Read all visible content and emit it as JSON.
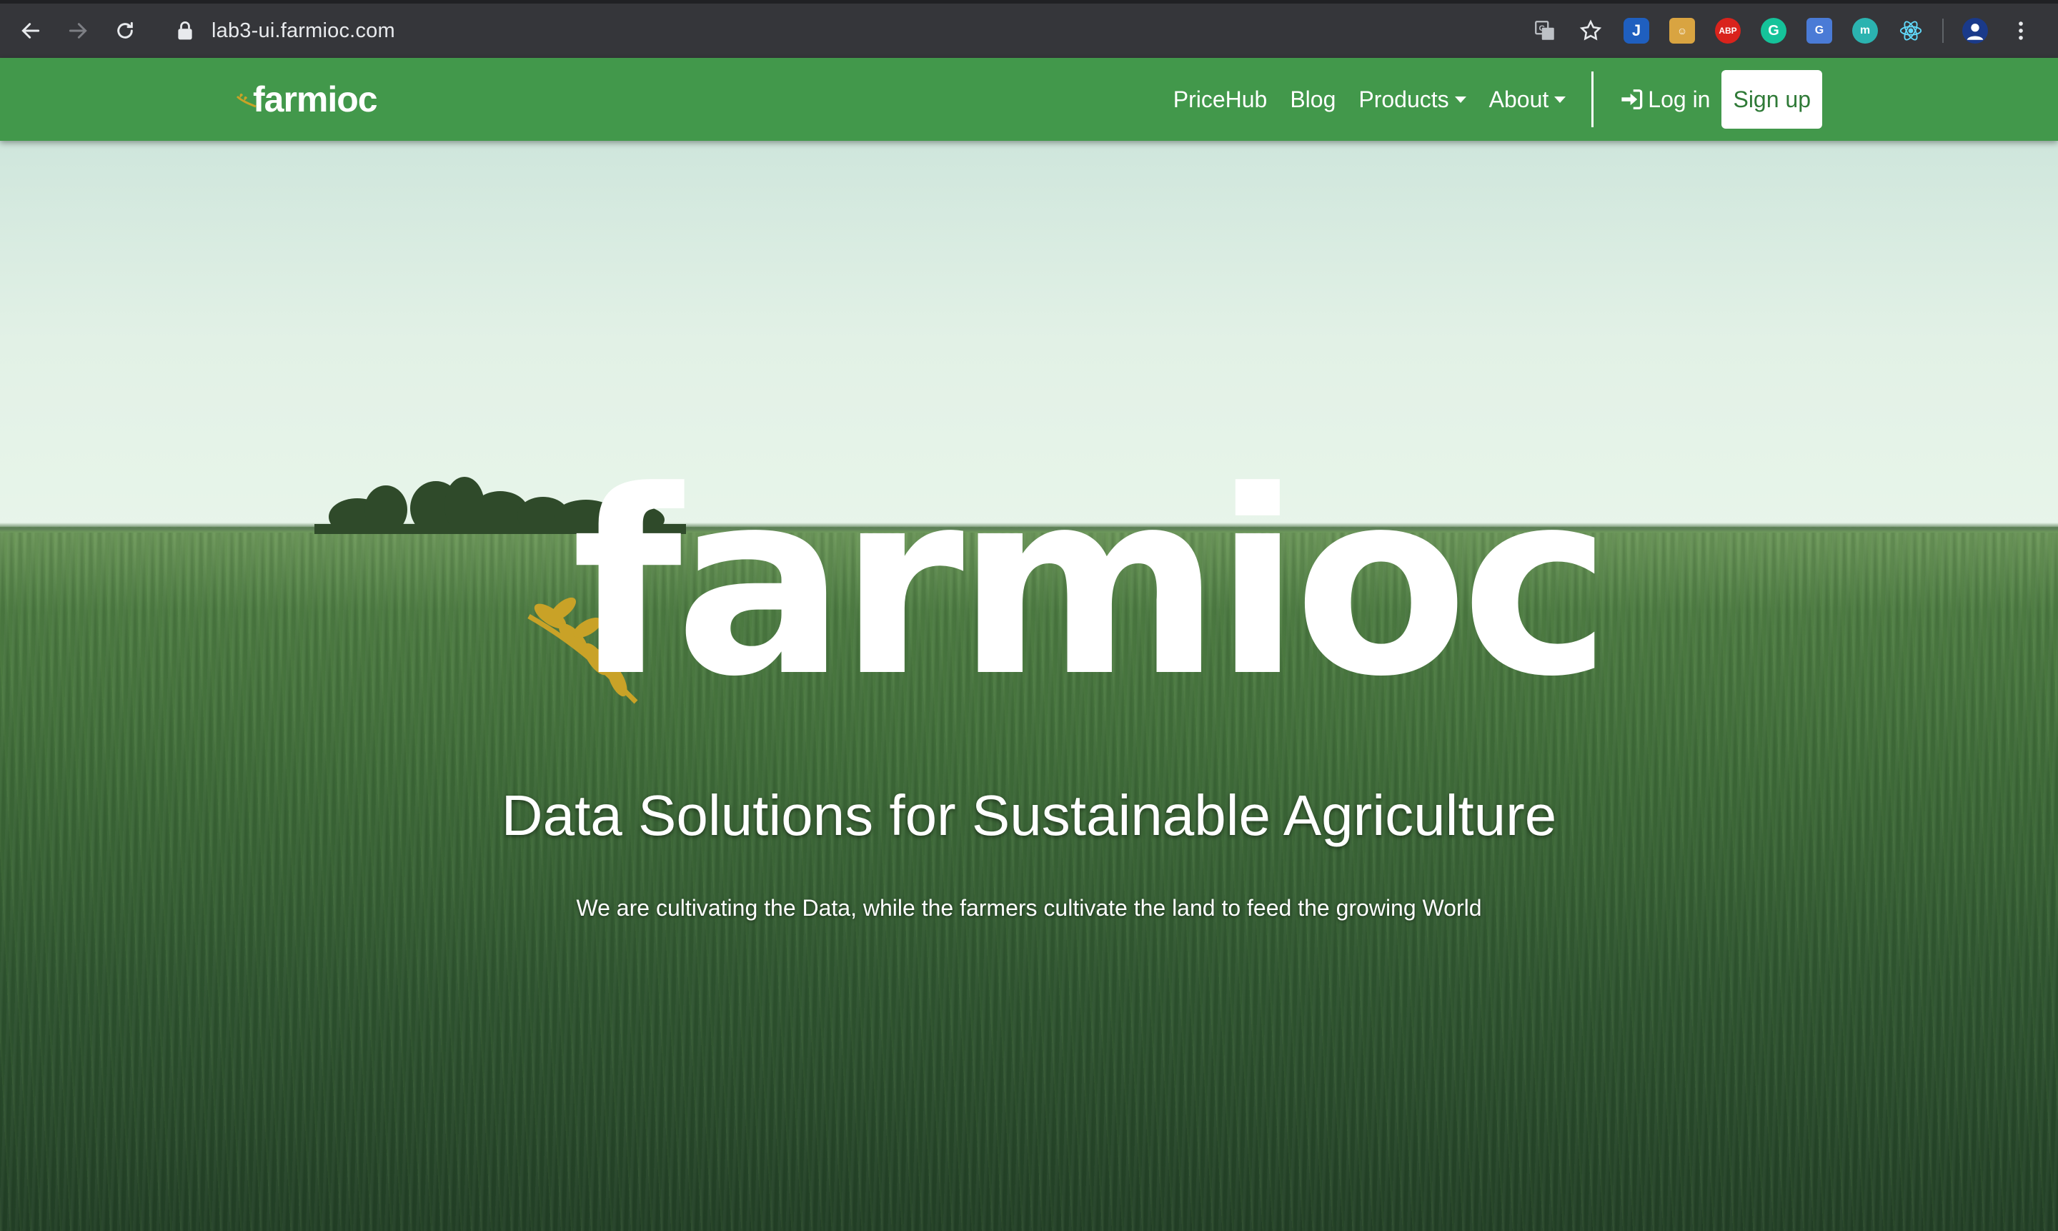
{
  "browser": {
    "url": "lab3-ui.farmioc.com",
    "extensions": [
      {
        "name": "translate-icon",
        "color": "#35363a"
      },
      {
        "name": "bookmark-star-icon",
        "color": "#35363a"
      },
      {
        "name": "extension-j-icon",
        "color": "#1f5fbf"
      },
      {
        "name": "extension-face-icon",
        "color": "#d9a441"
      },
      {
        "name": "adblock-plus-icon",
        "color": "#d9231c",
        "label": "ABP"
      },
      {
        "name": "grammarly-icon",
        "color": "#15c39a",
        "label": "G"
      },
      {
        "name": "google-translate-icon",
        "color": "#4a7bd6"
      },
      {
        "name": "extension-m-icon",
        "color": "#2bb3b0"
      },
      {
        "name": "react-devtools-icon",
        "color": "#35363a"
      },
      {
        "name": "profile-avatar-icon",
        "color": "#1a3a8a"
      },
      {
        "name": "chrome-menu-icon",
        "color": "#35363a"
      }
    ]
  },
  "navbar": {
    "brand": "farmioc",
    "links": [
      {
        "label": "PriceHub"
      },
      {
        "label": "Blog"
      },
      {
        "label": "Products"
      },
      {
        "label": "About"
      }
    ],
    "login_label": "Log in",
    "signup_label": "Sign up",
    "bg_color": "#42984b"
  },
  "hero": {
    "logo_text": "farmioc",
    "title": "Data Solutions for Sustainable Agriculture",
    "subtitle": "We are cultivating the Data, while the farmers cultivate the land to feed the growing World"
  }
}
